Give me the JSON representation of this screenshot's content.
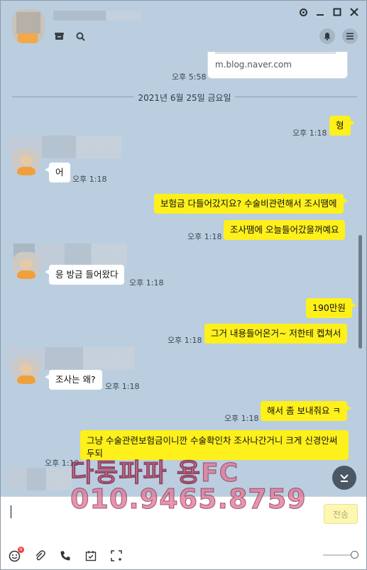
{
  "header": {
    "search_icon": "search-icon",
    "window_controls": [
      "settings-icon",
      "minimize-icon",
      "maximize-icon",
      "close-icon"
    ]
  },
  "chat": {
    "link_url": "m.blog.naver.com",
    "link_time": "오후 5:58",
    "date_divider": "2021년 6월 25일 금요일",
    "messages": [
      {
        "side": "me",
        "text": "형",
        "time": "오후 1:18"
      },
      {
        "side": "other",
        "text": "어",
        "time": "오후 1:18"
      },
      {
        "side": "me",
        "text": "보험금 다들어갔지요? 수술비관련해서 조시땜에",
        "time": ""
      },
      {
        "side": "me",
        "text": "조사땜에 오늘들어갔을꺼예요",
        "time": "오후 1:18"
      },
      {
        "side": "other",
        "text": "응 방금 들어왔다",
        "time": "오후 1:18"
      },
      {
        "side": "me",
        "text": "190만원",
        "time": ""
      },
      {
        "side": "me",
        "text": "그거 내용들어온거~ 저한테 켑쳐서",
        "time": "오후 1:18"
      },
      {
        "side": "other",
        "text": "조사는 왜?",
        "time": "오후 1:18"
      },
      {
        "side": "me",
        "text": "해서 좀 보내줘요 ㅋ",
        "time": "오후 1:18"
      },
      {
        "side": "me",
        "text": "그냥 수술관련보험금이니깐  수술확인차 조사나간거니 크게 신경안써두되",
        "time": "오후 1:19"
      }
    ]
  },
  "watermark": {
    "line1": "다둥파파 용FC",
    "line2": "010.9465.8759"
  },
  "input": {
    "send_label": "전송"
  },
  "toolbar": {
    "emoji_badge": "N"
  }
}
